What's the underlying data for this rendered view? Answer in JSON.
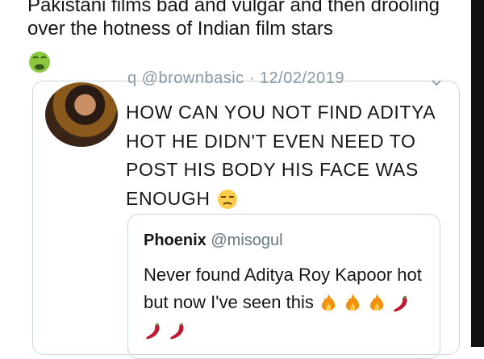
{
  "outer_tweet": {
    "text": "Pakistani films bad and vulgar and then drooling over the hotness of Indian film stars",
    "emoji": "nauseated-face"
  },
  "quoted_tweet": {
    "meta": "q @brownbasic · 12/02/2019",
    "text": "HOW CAN YOU NOT FIND ADITYA HOT HE DIDN'T EVEN NEED TO POST HIS BODY HIS FACE WAS ENOUGH",
    "emoji": "unamused-face"
  },
  "nested_quote": {
    "name": "Phoenix",
    "handle": "@misogul",
    "text": "Never found Aditya Roy Kapoor hot but now I've seen this",
    "emojis": [
      "fire",
      "fire",
      "fire",
      "hot-pepper",
      "hot-pepper",
      "hot-pepper"
    ]
  },
  "colors": {
    "border": "#ccd6dd",
    "muted": "#8899a6",
    "text": "#14171a"
  }
}
